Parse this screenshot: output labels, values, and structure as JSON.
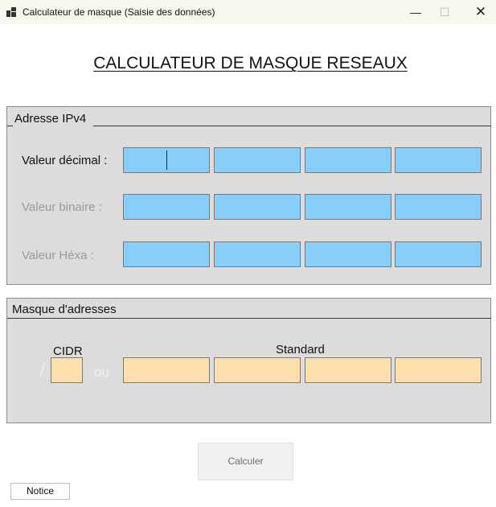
{
  "window": {
    "title": "Calculateur de masque (Saisie des données)",
    "minimize_icon": "minimize-icon",
    "maximize_icon": "maximize-icon",
    "close_icon": "close-icon"
  },
  "main_title": "CALCULATEUR DE MASQUE RESEAUX",
  "ipv4_group": {
    "title": "Adresse IPv4",
    "rows": [
      {
        "label": "Valeur décimal :",
        "state": "active",
        "values": [
          "",
          "",
          "",
          ""
        ]
      },
      {
        "label": "Valeur binaire  :",
        "state": "disabled",
        "values": [
          "",
          "",
          "",
          ""
        ]
      },
      {
        "label": "Valeur Héxa :",
        "state": "disabled",
        "values": [
          "",
          "",
          "",
          ""
        ]
      }
    ],
    "field_color": "#87cefa"
  },
  "mask_group": {
    "title": "Masque d'adresses",
    "cidr_label": "CIDR",
    "slash": "/",
    "or_label": "ou",
    "standard_label": "Standard",
    "cidr_value": "",
    "standard_values": [
      "",
      "",
      "",
      ""
    ],
    "field_color": "#ffdead"
  },
  "buttons": {
    "calculate": "Calculer",
    "notice": "Notice"
  }
}
